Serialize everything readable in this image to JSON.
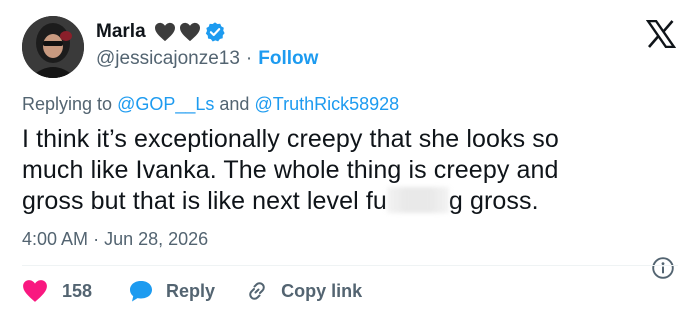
{
  "author": {
    "name": "Marla",
    "handle": "@jessicajonze13",
    "separator": "·",
    "follow_label": "Follow"
  },
  "reply_context": {
    "prefix": "Replying to",
    "mention_1": "@GOP__Ls",
    "conjunction": "and",
    "mention_2": "@TruthRick58928"
  },
  "tweet": {
    "line_1": "I think it’s exceptionally creepy that she looks so",
    "line_2": "much like Ivanka.  The whole thing is creepy and",
    "line_3_before": "gross but that is like next level fu",
    "line_3_after": "g gross."
  },
  "meta": {
    "time": "4:00 AM",
    "separator": "·",
    "date": "Jun 28, 2026"
  },
  "actions": {
    "like_count": "158",
    "reply_label": "Reply",
    "copy_link_label": "Copy link"
  },
  "icons": {
    "hearts": [
      "black-heart-icon",
      "black-heart-icon"
    ],
    "verified": "verified-badge-icon",
    "logo": "x-logo-icon",
    "info": "info-icon",
    "like": "heart-icon",
    "reply": "speech-bubble-icon",
    "copy": "link-icon"
  },
  "colors": {
    "accent": "#1d9bf0",
    "like": "#f91880",
    "secondary_text": "#536471",
    "primary_text": "#0f1419"
  }
}
